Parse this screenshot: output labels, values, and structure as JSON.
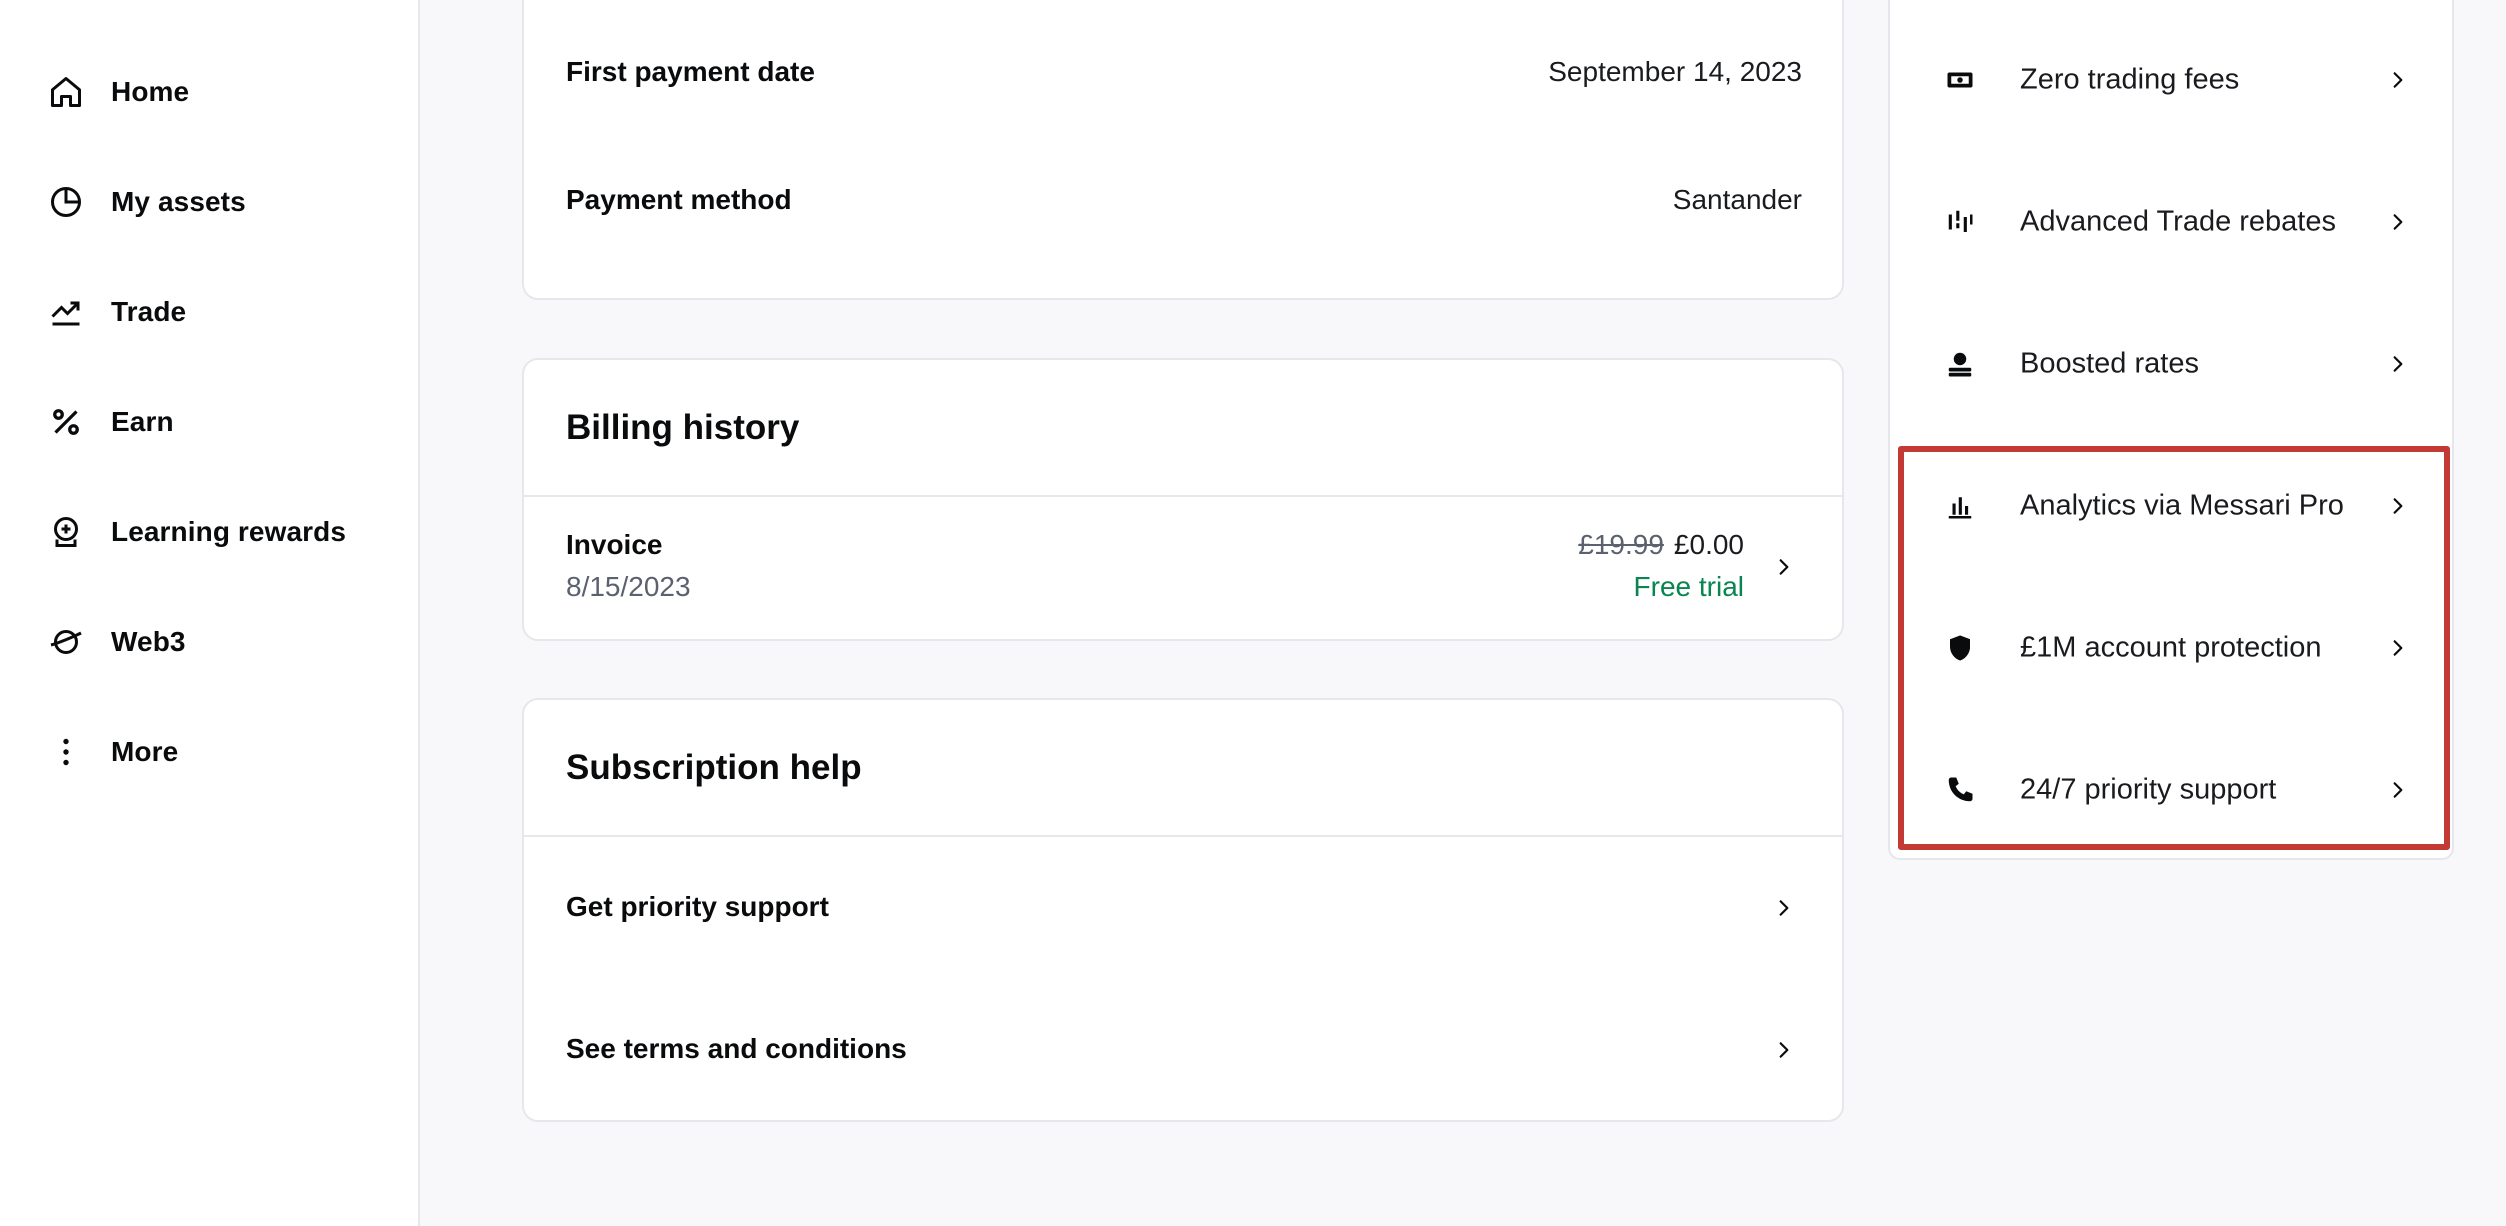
{
  "sidebar": {
    "items": [
      {
        "label": "Home",
        "icon": "home-icon"
      },
      {
        "label": "My assets",
        "icon": "pie-chart-icon"
      },
      {
        "label": "Trade",
        "icon": "trend-icon"
      },
      {
        "label": "Earn",
        "icon": "percent-icon"
      },
      {
        "label": "Learning rewards",
        "icon": "learning-icon"
      },
      {
        "label": "Web3",
        "icon": "planet-icon"
      },
      {
        "label": "More",
        "icon": "more-icon"
      }
    ]
  },
  "payment_card": {
    "first_payment_label": "First payment date",
    "first_payment_value": "September 14, 2023",
    "method_label": "Payment method",
    "method_value": "Santander"
  },
  "billing": {
    "title": "Billing history",
    "invoice_label": "Invoice",
    "invoice_date": "8/15/2023",
    "original_price": "£19.99",
    "price": "£0.00",
    "status": "Free trial"
  },
  "help": {
    "title": "Subscription help",
    "items": [
      {
        "label": "Get priority support"
      },
      {
        "label": "See terms and conditions"
      }
    ]
  },
  "benefits": {
    "items": [
      {
        "label": "Zero trading fees",
        "icon": "cash-icon"
      },
      {
        "label": "Advanced Trade rebates",
        "icon": "candlestick-icon"
      },
      {
        "label": "Boosted rates",
        "icon": "stake-icon"
      },
      {
        "label": "Analytics via Messari Pro",
        "icon": "bar-chart-icon"
      },
      {
        "label": "£1M account protection",
        "icon": "shield-icon"
      },
      {
        "label": "24/7 priority support",
        "icon": "phone-icon"
      }
    ]
  },
  "colors": {
    "accent_green": "#098551",
    "highlight_red": "#c23a33"
  }
}
